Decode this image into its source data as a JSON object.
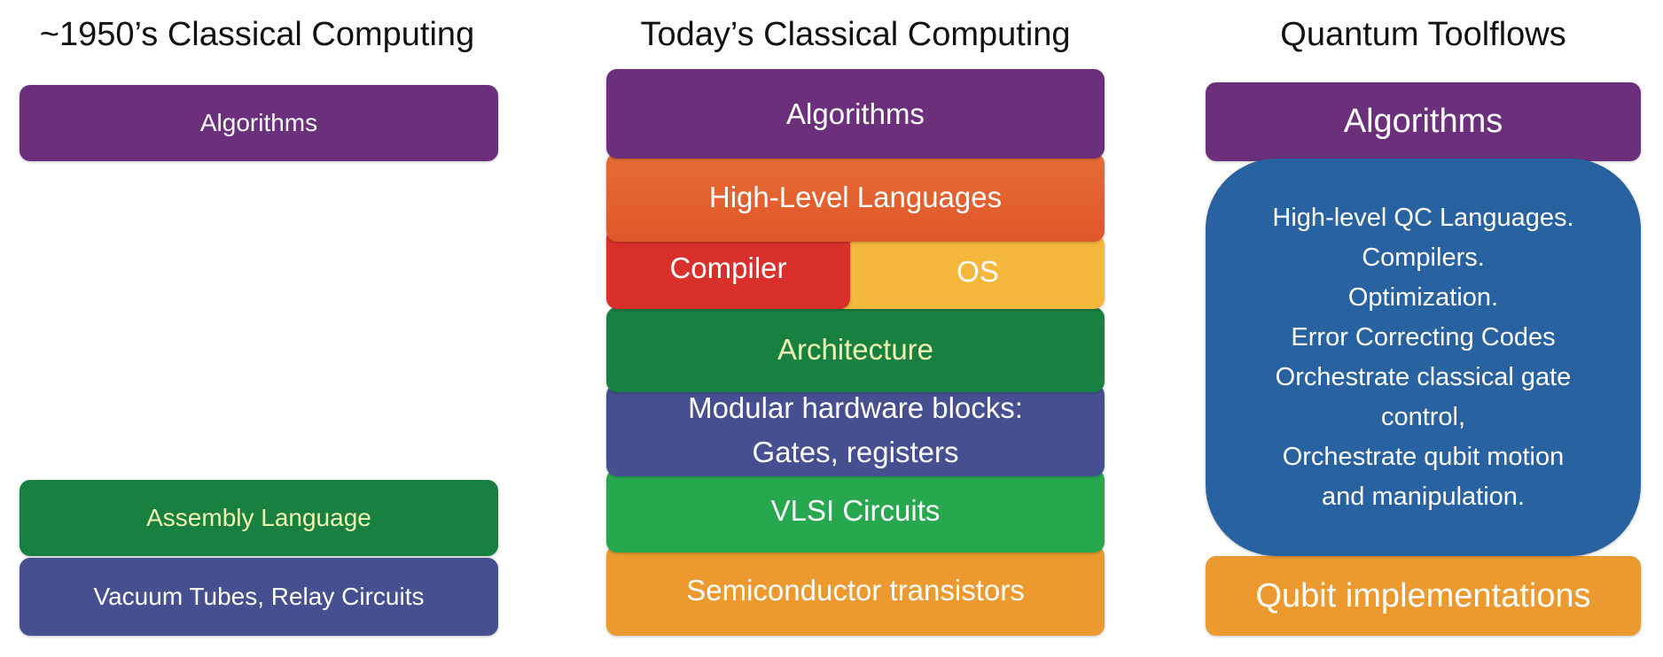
{
  "columns": [
    {
      "title": "~1950’s Classical Computing",
      "layers": [
        "Algorithms",
        "Assembly Language",
        "Vacuum Tubes, Relay Circuits"
      ]
    },
    {
      "title": "Today’s Classical Computing",
      "layers": [
        "Algorithms",
        "High-Level Languages",
        "Compiler",
        "OS",
        "Architecture",
        "Modular hardware blocks:",
        "Gates, registers",
        "VLSI Circuits",
        "Semiconductor transistors"
      ]
    },
    {
      "title": "Quantum Toolflows",
      "layers": [
        "Algorithms",
        "Qubit implementations"
      ],
      "toolflow_lines": [
        "High-level QC Languages.",
        "Compilers.",
        "Optimization.",
        "Error Correcting Codes",
        "Orchestrate classical gate",
        "control,",
        "Orchestrate qubit motion",
        "and manipulation."
      ]
    }
  ],
  "colors": {
    "algorithms": "#6b2f7b",
    "high_level_languages": "#e0562b",
    "compiler": "#d9302c",
    "os": "#f5b83d",
    "architecture": "#188040",
    "hardware_blocks": "#464f90",
    "vlsi": "#27a84f",
    "transistors": "#ec9a30",
    "quantum_toolflow": "#2862a0"
  }
}
